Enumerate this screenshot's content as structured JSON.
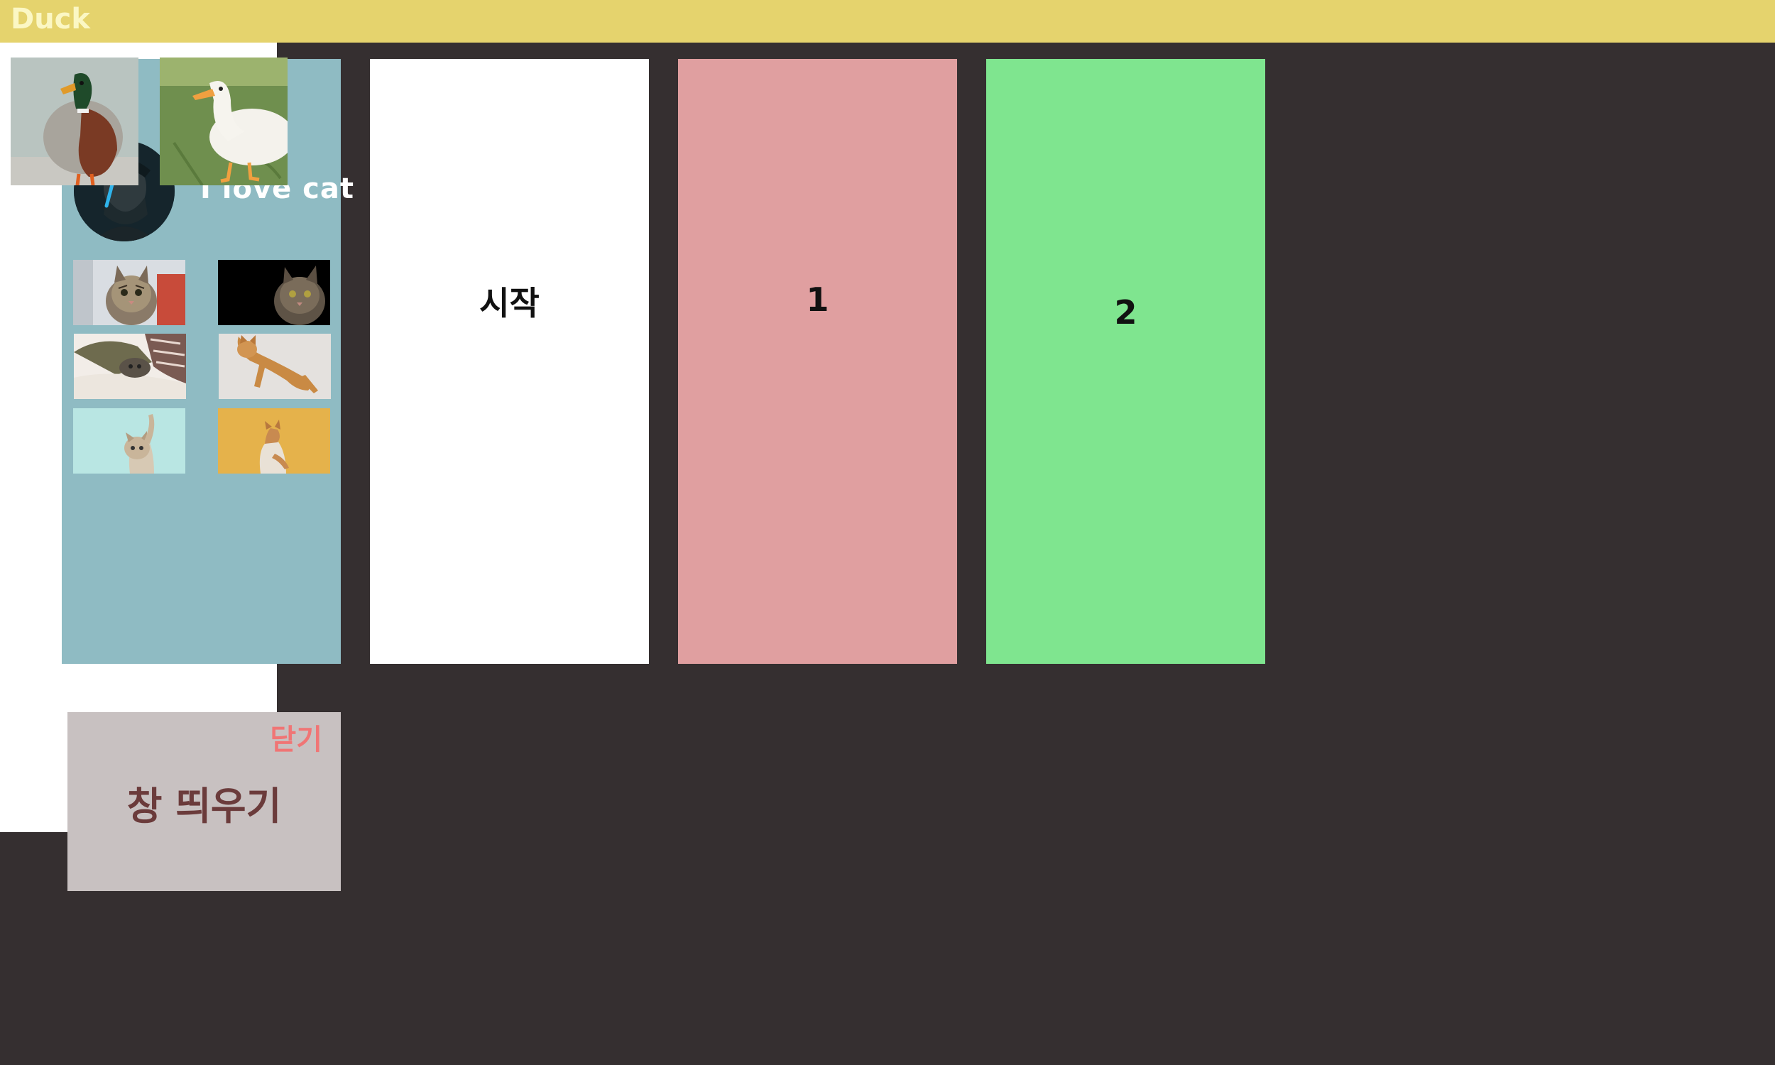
{
  "profile": {
    "title": "I love cat",
    "avatar_icon": "avatar-person-icon",
    "cat_photos": [
      {
        "name": "cat-photo-1",
        "bg": "#d9dde2"
      },
      {
        "name": "cat-photo-2",
        "bg": "#000000"
      },
      {
        "name": "cat-photo-3",
        "bg": "#d9cdc1"
      },
      {
        "name": "cat-photo-4",
        "bg": "#e4e1de"
      },
      {
        "name": "cat-photo-5",
        "bg": "#b9e6e3"
      },
      {
        "name": "cat-photo-6",
        "bg": "#e5b24b"
      }
    ],
    "bg_color": "#8fbbc3"
  },
  "panels": {
    "start_label": "시작",
    "one_label": "1",
    "two_label": "2",
    "start_color": "#ffffff",
    "one_color": "#e09fa0",
    "two_color": "#7fe58f"
  },
  "duck": {
    "title": "Duck",
    "header_color": "#e5d36d",
    "photos": [
      {
        "name": "duck-photo-mallard"
      },
      {
        "name": "duck-photo-white"
      }
    ]
  },
  "popup": {
    "close_label": "닫기",
    "open_label": "창 띄우기",
    "bg_color": "#c8c1c1",
    "close_color": "#f07575"
  }
}
